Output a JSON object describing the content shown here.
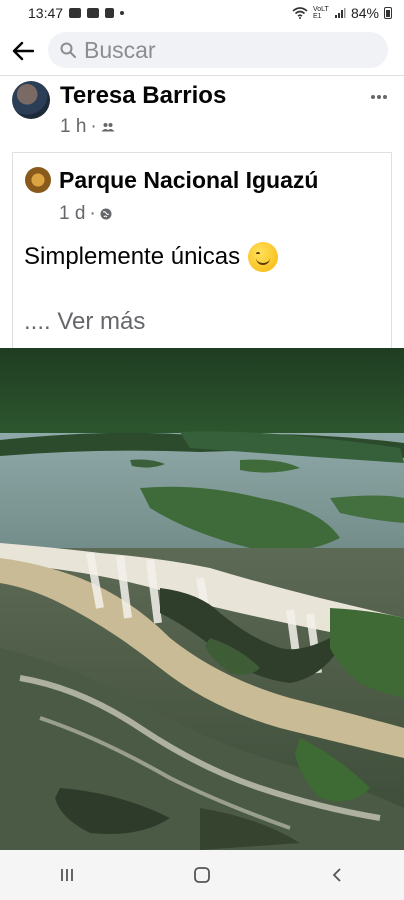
{
  "status_bar": {
    "time": "13:47",
    "network": "VoLTE1",
    "battery": "84%"
  },
  "search": {
    "placeholder": "Buscar"
  },
  "post": {
    "author": "Teresa Barrios",
    "time": "1 h",
    "audience_icon": "friends-icon"
  },
  "shared": {
    "page_name": "Parque Nacional Iguazú",
    "time": "1 d",
    "audience_icon": "globe-icon",
    "text": "Simplemente únicas",
    "emoji": "smiling-face-emoji",
    "see_more": ".... Ver más"
  },
  "photo": {
    "subject": "iguazu-falls-aerial-photo"
  },
  "nav": {
    "buttons": [
      "recent-apps-button",
      "home-button",
      "back-button"
    ]
  },
  "colors": {
    "text_primary": "#050505",
    "text_secondary": "#65676b",
    "search_bg": "#f0f2f5"
  }
}
